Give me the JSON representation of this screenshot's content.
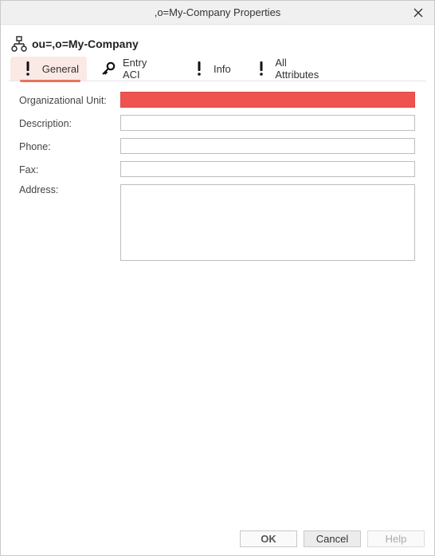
{
  "window": {
    "title": ",o=My-Company Properties",
    "close_icon": "close-icon"
  },
  "entry": {
    "icon": "tree-node-icon",
    "title": "ou=,o=My-Company"
  },
  "tabs": [
    {
      "label": "General",
      "icon": "exclamation-icon",
      "active": true
    },
    {
      "label": "Entry ACI",
      "icon": "key-icon",
      "active": false
    },
    {
      "label": "Info",
      "icon": "exclamation-icon",
      "active": false
    },
    {
      "label": "All Attributes",
      "icon": "exclamation-icon",
      "active": false
    }
  ],
  "form": {
    "org_unit": {
      "label": "Organizational Unit:",
      "value": "",
      "state": "error"
    },
    "description": {
      "label": "Description:",
      "value": ""
    },
    "phone": {
      "label": "Phone:",
      "value": ""
    },
    "fax": {
      "label": "Fax:",
      "value": ""
    },
    "address": {
      "label": "Address:",
      "value": ""
    }
  },
  "buttons": {
    "ok": "OK",
    "cancel": "Cancel",
    "help": "Help"
  },
  "colors": {
    "error_field": "#ef5350",
    "active_tab_bg": "#fbe9e6",
    "active_tab_underline": "#e8735e"
  }
}
